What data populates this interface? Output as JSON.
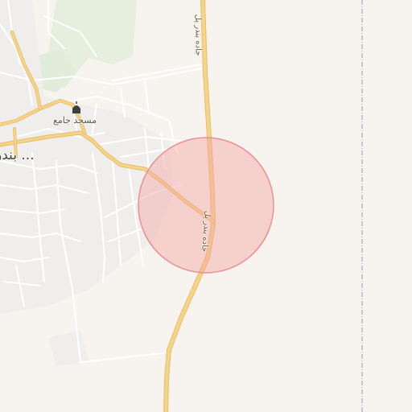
{
  "map": {
    "labels": {
      "mosque": "مسجد جامع",
      "town": "بندر ...",
      "road_north": "جاده بندر پل",
      "road_center": "جاده بندر پل"
    },
    "icons": {
      "mosque": "mosque-icon"
    },
    "highlight": {
      "type": "circle",
      "fill": "#f4a3a3",
      "stroke": "#ee8f8f"
    },
    "colors": {
      "background": "#f7f4ef",
      "major_road": "#f4cd7c",
      "minor_road": "#ffffff",
      "green_area": "#e7efe0",
      "builtup": "#efeeec",
      "boundary": "#9aa0a6"
    }
  }
}
